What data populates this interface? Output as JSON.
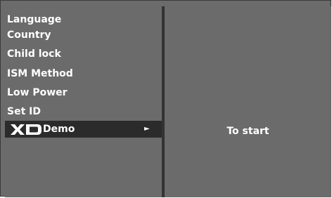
{
  "menu": {
    "items": [
      {
        "label": "Language"
      },
      {
        "label": "Country"
      },
      {
        "label": "Child lock"
      },
      {
        "label": "ISM Method"
      },
      {
        "label": "Low Power"
      },
      {
        "label": "Set ID"
      }
    ],
    "selected_item": {
      "logo_icon": "xd-logo-icon",
      "label": "Demo",
      "arrow_glyph": "►"
    }
  },
  "info": {
    "text": "To start"
  },
  "colors": {
    "panel_bg": "#6b6b6b",
    "divider": "#333333",
    "selected_bg": "#2b2b2b",
    "text": "#ffffff"
  }
}
